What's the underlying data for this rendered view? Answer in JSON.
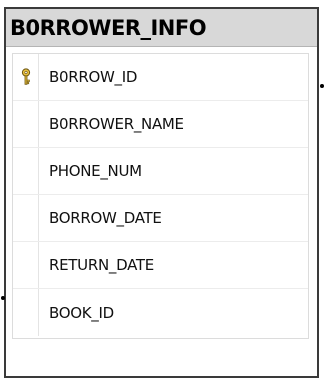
{
  "table": {
    "title": "B0RROWER_INFO",
    "columns": [
      {
        "name": "B0RROW_ID",
        "primary_key": true,
        "key_icon": "primary-key-icon"
      },
      {
        "name": "B0RROWER_NAME",
        "primary_key": false
      },
      {
        "name": "PHONE_NUM",
        "primary_key": false
      },
      {
        "name": "BORROW_DATE",
        "primary_key": false
      },
      {
        "name": "RETURN_DATE",
        "primary_key": false
      },
      {
        "name": "BOOK_ID",
        "primary_key": false
      }
    ]
  },
  "colors": {
    "title_bar": "#d8d8d8",
    "border": "#3a3a3a",
    "key_icon": "#e0b020"
  }
}
